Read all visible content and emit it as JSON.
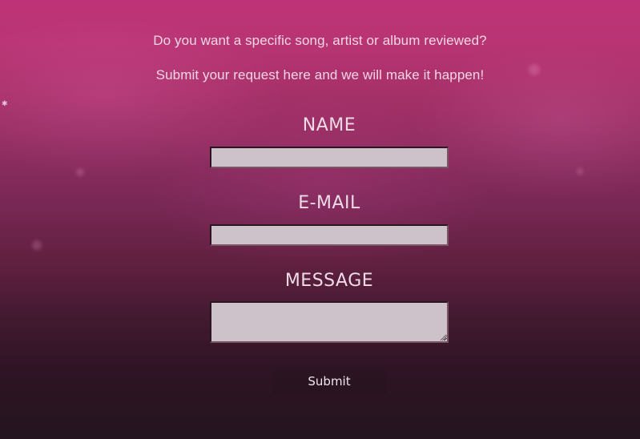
{
  "intro": {
    "line1": "Do you want a specific song, artist or album reviewed?",
    "line2": "Submit your request here and we will make it happen!"
  },
  "form": {
    "name_label": "NAME",
    "name_value": "",
    "email_label": "E-MAIL",
    "email_value": "",
    "message_label": "MESSAGE",
    "message_value": "",
    "submit_label": "Submit"
  },
  "colors": {
    "background_top": "#be3377",
    "background_bottom": "#241520",
    "field_fill": "#cdc2ca",
    "text": "#f0d7e4"
  }
}
